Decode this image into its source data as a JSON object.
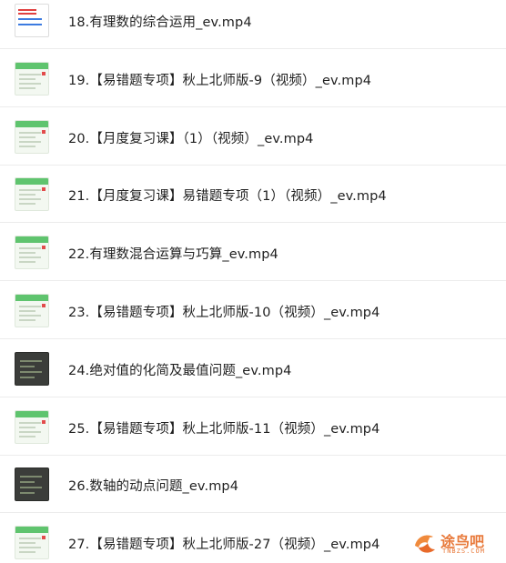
{
  "files": [
    {
      "name": "18.有理数的综合运用_ev.mp4",
      "thumb": "first"
    },
    {
      "name": "19.【易错题专项】秋上北师版-9（视频）_ev.mp4",
      "thumb": "light"
    },
    {
      "name": "20.【月度复习课】（1）（视频）_ev.mp4",
      "thumb": "light"
    },
    {
      "name": "21.【月度复习课】易错题专项（1）（视频）_ev.mp4",
      "thumb": "light"
    },
    {
      "name": "22.有理数混合运算与巧算_ev.mp4",
      "thumb": "light"
    },
    {
      "name": "23.【易错题专项】秋上北师版-10（视频）_ev.mp4",
      "thumb": "light"
    },
    {
      "name": "24.绝对值的化简及最值问题_ev.mp4",
      "thumb": "dark"
    },
    {
      "name": "25.【易错题专项】秋上北师版-11（视频）_ev.mp4",
      "thumb": "light"
    },
    {
      "name": "26.数轴的动点问题_ev.mp4",
      "thumb": "dark"
    },
    {
      "name": "27.【易错题专项】秋上北师版-27（视频）_ev.mp4",
      "thumb": "light"
    }
  ],
  "watermark": {
    "text": "途鸟吧",
    "sub": "TNBZS.COM"
  },
  "colors": {
    "accent_green": "#5fc46e",
    "watermark_orange": "#e8793a"
  }
}
